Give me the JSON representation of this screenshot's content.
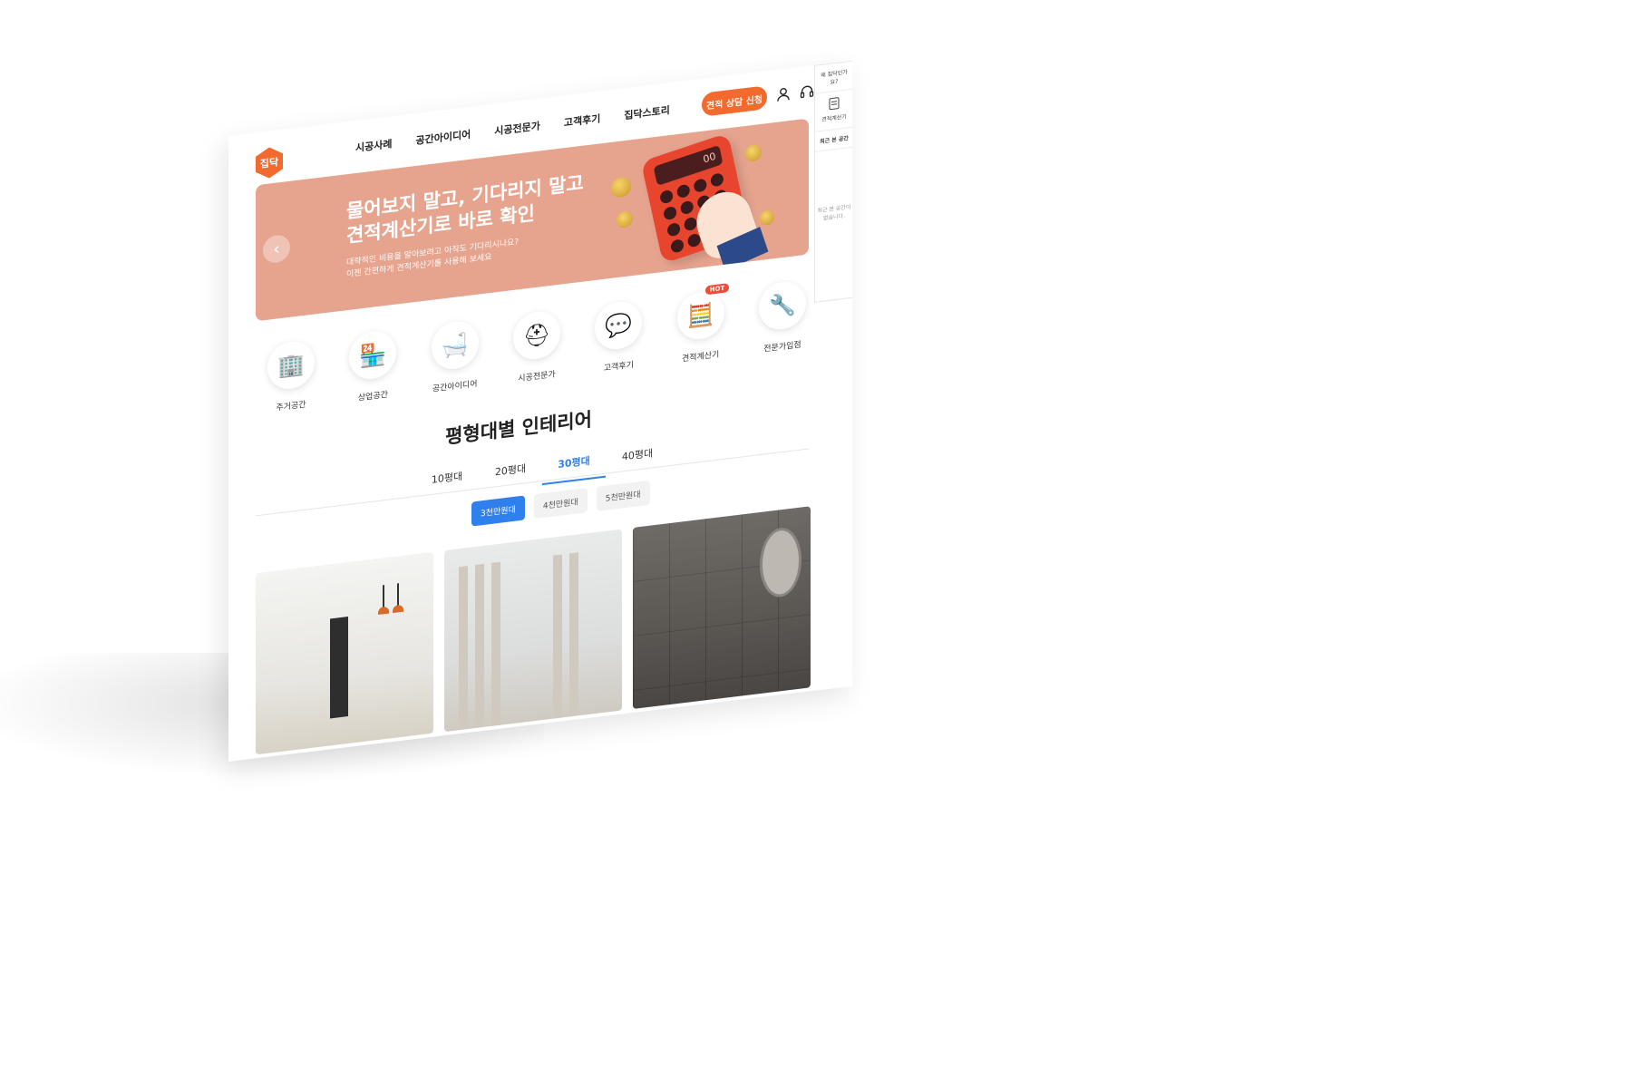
{
  "header": {
    "logo_text": "집닥",
    "nav": [
      "시공사례",
      "공간아이디어",
      "시공전문가",
      "고객후기",
      "집닥스토리"
    ],
    "cta_label": "견적 상담 신청"
  },
  "banner": {
    "title": "물어보지 말고, 기다리지 말고\n견적계산기로 바로 확인",
    "subtitle": "대략적인 비용을 알아보려고 아직도 기다리시나요?\n이젠 간편하게 견적계산기를 사용해 보세요",
    "calc_display": "00"
  },
  "quick_menu": {
    "title": "왜 집닥인가요?",
    "calculator": "견적계산기",
    "recent_title": "최근 본 공간",
    "recent_empty": "최근 본 공간이 없습니다."
  },
  "categories": [
    {
      "label": "주거공간",
      "icon": "building-icon"
    },
    {
      "label": "상업공간",
      "icon": "storefront-icon"
    },
    {
      "label": "공간아이디어",
      "icon": "bathtub-icon"
    },
    {
      "label": "시공전문가",
      "icon": "helmet-icon"
    },
    {
      "label": "고객후기",
      "icon": "chat-review-icon"
    },
    {
      "label": "견적계산기",
      "icon": "calculator-icon",
      "badge": "HOT"
    },
    {
      "label": "전문가입점",
      "icon": "tool-icon"
    }
  ],
  "section": {
    "title": "평형대별 인테리어",
    "tabs": [
      "10평대",
      "20평대",
      "30평대",
      "40평대"
    ],
    "active_tab": "30평대",
    "price_chips": [
      "3천만원대",
      "4천만원대",
      "5천만원대"
    ],
    "active_chip": "3천만원대"
  },
  "colors": {
    "brand": "#f26a2e",
    "banner": "#e6a48f",
    "accent": "#2f80ed"
  }
}
